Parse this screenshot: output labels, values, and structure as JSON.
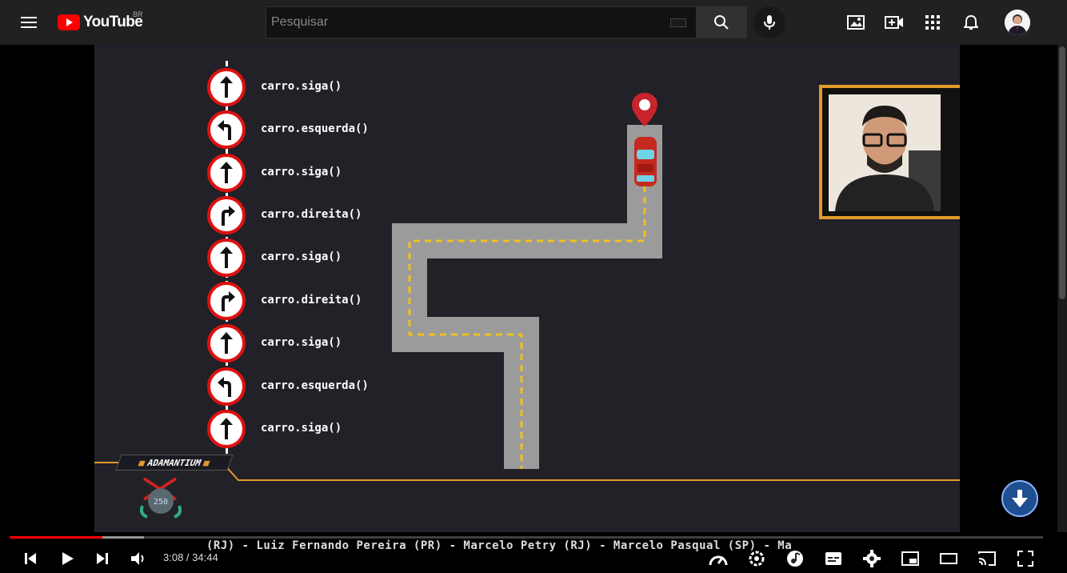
{
  "masthead": {
    "logo_text": "YouTube",
    "country_code": "BR",
    "search_placeholder": "Pesquisar"
  },
  "video": {
    "code_lines": [
      "carro.siga()",
      "carro.esquerda()",
      "carro.siga()",
      "carro.direita()",
      "carro.siga()",
      "carro.direita()",
      "carro.siga()",
      "carro.esquerda()",
      "carro.siga()"
    ],
    "sign_types": [
      "up-arrow",
      "left-turn-arrow",
      "up-arrow",
      "right-turn-arrow",
      "up-arrow",
      "right-turn-arrow",
      "up-arrow",
      "left-turn-arrow",
      "up-arrow"
    ],
    "banner_label": "ADAMANTIUM",
    "ticker": "(RJ) - Luiz Fernando Pereira (PR) - Marcelo Petry (RJ) - Marcelo Pasqual (SP) - Ma",
    "badge_number": "250",
    "accent_color": "#e39a2b"
  },
  "player": {
    "current_time": "3:08",
    "duration": "34:44",
    "time_display": "3:08 / 34:44",
    "progress_fraction": 0.09,
    "buffer_fraction": 0.13,
    "progress_color": "#ff0000"
  }
}
